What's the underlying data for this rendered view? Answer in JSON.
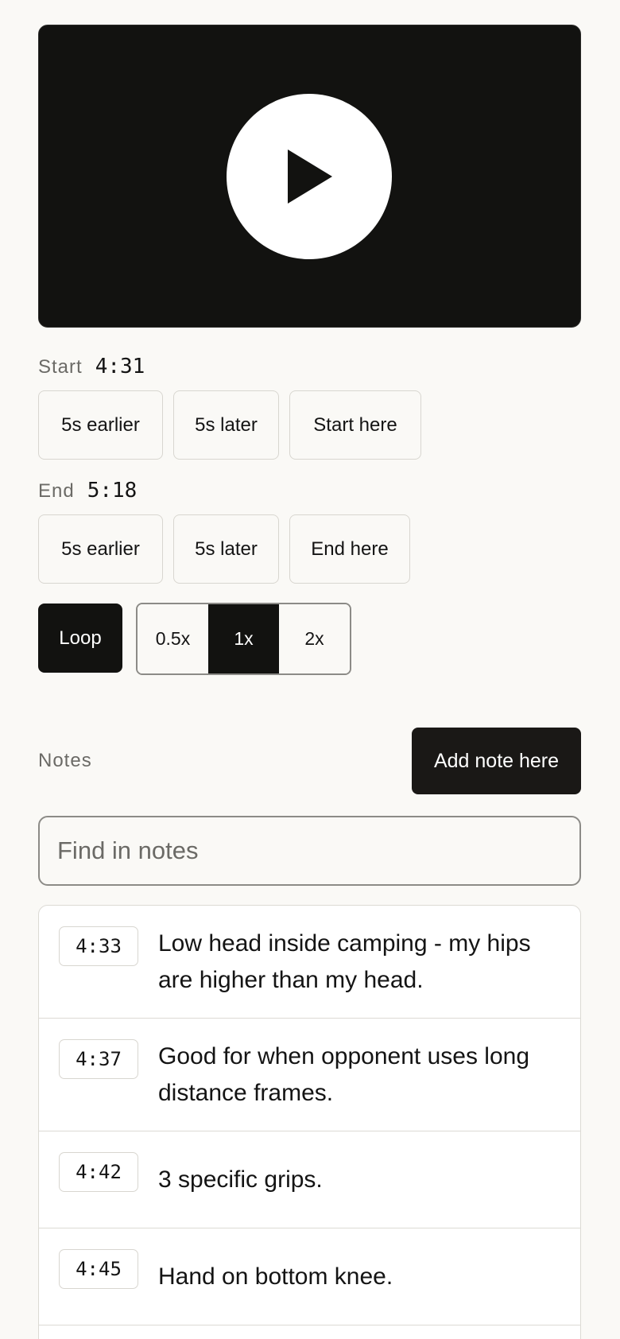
{
  "player": {
    "play_icon": "play-icon"
  },
  "start": {
    "label": "Start",
    "time": "4:31",
    "buttons": [
      "5s earlier",
      "5s later",
      "Start here"
    ]
  },
  "end": {
    "label": "End",
    "time": "5:18",
    "buttons": [
      "5s earlier",
      "5s later",
      "End here"
    ]
  },
  "playback": {
    "loop_label": "Loop",
    "speeds": [
      "0.5x",
      "1x",
      "2x"
    ],
    "active_speed": "1x"
  },
  "notes": {
    "title": "Notes",
    "add_label": "Add note here",
    "search_placeholder": "Find in notes",
    "items": [
      {
        "time": "4:33",
        "text": "Low head inside camping - my hips are higher than my head."
      },
      {
        "time": "4:37",
        "text": "Good for when opponent uses long distance frames."
      },
      {
        "time": "4:42",
        "text": "3 specific grips."
      },
      {
        "time": "4:45",
        "text": "Hand on bottom knee."
      }
    ]
  },
  "colors": {
    "background": "#faf9f6",
    "dark": "#121210",
    "muted": "#6b6a66"
  }
}
